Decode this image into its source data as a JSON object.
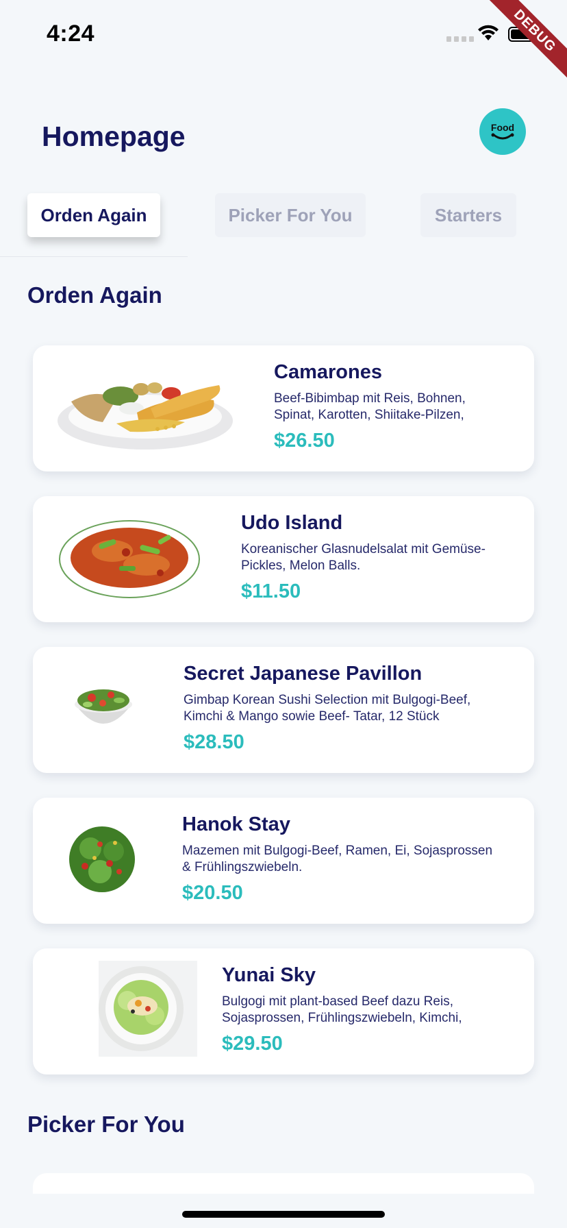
{
  "status_bar": {
    "time": "4:24",
    "debug_banner": "DEBUG"
  },
  "header": {
    "title": "Homepage",
    "logo_text": "Food"
  },
  "tabs": [
    {
      "label": "Orden Again",
      "active": true
    },
    {
      "label": "Picker For You",
      "active": false
    },
    {
      "label": "Starters",
      "active": false
    }
  ],
  "sections": {
    "orden_again": "Orden Again",
    "picker_for_you": "Picker For You"
  },
  "items": [
    {
      "name": "Camarones",
      "desc_line1": "Beef-Bibimbap mit Reis, Bohnen,",
      "desc_line2": "Spinat, Karotten, Shiitake-Pilzen,",
      "price": "$26.50",
      "image": "fried-shrimp-plate"
    },
    {
      "name": "Udo Island",
      "desc_line1": "Koreanischer Glasnudelsalat mit Gemüse-",
      "desc_line2": "Pickles, Melon Balls.",
      "price": "$11.50",
      "image": "chili-chicken-platter"
    },
    {
      "name": "Secret Japanese Pavillon",
      "desc_line1": "Gimbap Korean Sushi Selection mit Bulgogi-Beef,",
      "desc_line2": "Kimchi & Mango sowie Beef- Tatar, 12 Stück",
      "price": "$28.50",
      "image": "salad-bowl"
    },
    {
      "name": "Hanok Stay",
      "desc_line1": "Mazemen mit Bulgogi-Beef, Ramen, Ei, Sojasprossen",
      "desc_line2": "& Frühlingszwiebeln.",
      "price": "$20.50",
      "image": "green-salad"
    },
    {
      "name": "Yunai Sky",
      "desc_line1": "Bulgogi mit plant-based Beef dazu Reis,",
      "desc_line2": "Sojasprossen, Frühlingszwiebeln, Kimchi,",
      "price": "$29.50",
      "image": "noodle-salad-plate"
    }
  ],
  "colors": {
    "accent": "#2bbcbc",
    "title": "#16185e",
    "logo": "#2ec4c6",
    "background": "#f4f7fa"
  }
}
